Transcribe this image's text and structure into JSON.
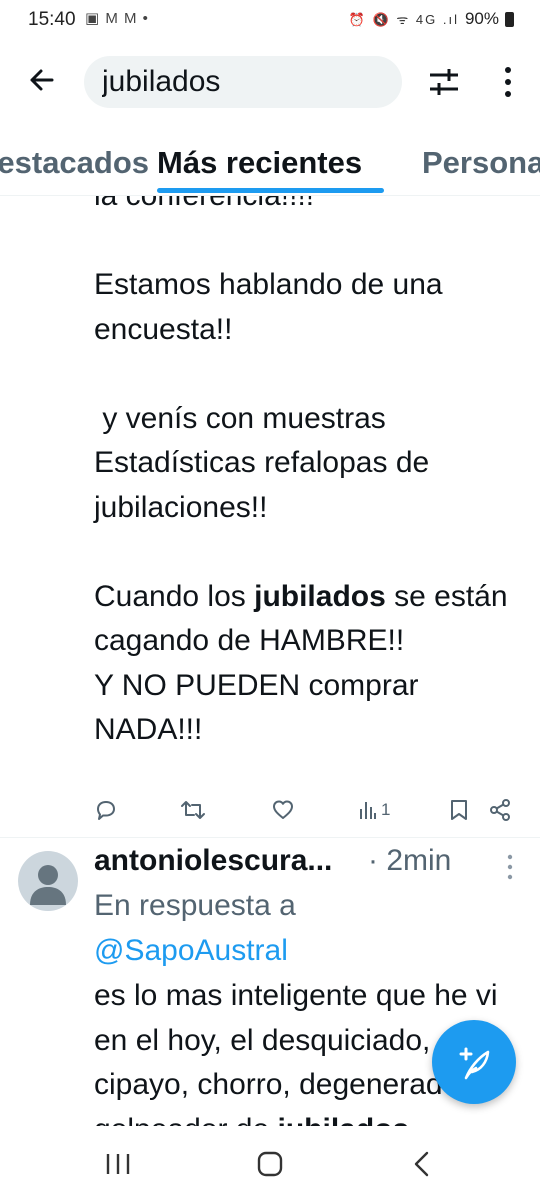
{
  "status_bar": {
    "time": "15:40",
    "notification_icons": "▣ M M •",
    "system_icons": "⏰ 🔇 ᯤ 4G .ıl",
    "battery": "90%"
  },
  "search": {
    "query": "jubilados"
  },
  "tabs": [
    {
      "label": "Destacados"
    },
    {
      "label": "Más recientes",
      "active": true
    },
    {
      "label": "Personas"
    }
  ],
  "tweet": {
    "text_cut": "la conferencia!!!!",
    "paragraph_1": "Estamos hablando de una encuesta!!",
    "paragraph_2": " y venís con muestras Estadísticas refalopas de jubilaciones!!",
    "p3_before": "Cuando los ",
    "p3_highlight": "jubilados",
    "p3_after": " se están cagando de HAMBRE!!\nY NO PUEDEN comprar NADA!!!",
    "views": "1",
    "action_icons": [
      "reply-icon",
      "retweet-icon",
      "like-icon",
      "views-icon",
      "bookmark-icon",
      "share-icon"
    ]
  },
  "reply": {
    "author": "antoniolescura...",
    "time": "· 2min",
    "replying_prefix": "En respuesta a ",
    "replying_to": "@SapoAustral",
    "text_before": "es lo mas inteligente que he vi en el hoy, el desquiciado, cipayo, chorro, degenerado, golpeador de ",
    "text_highlight": "jubilados"
  },
  "colors": {
    "accent": "#1d9bf0",
    "text": "#0f1419",
    "secondary": "#536471",
    "search_bg": "#eff3f4"
  }
}
